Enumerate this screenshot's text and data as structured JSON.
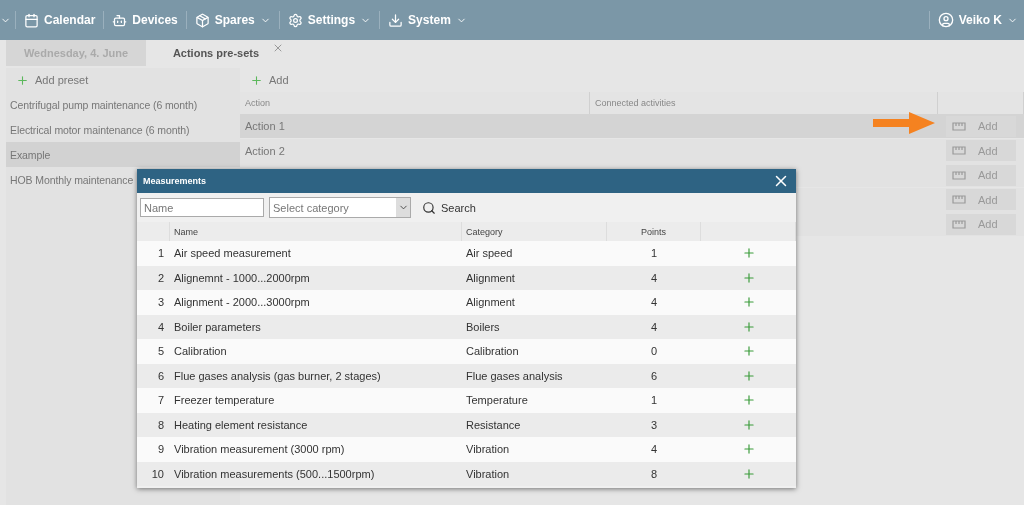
{
  "nav": {
    "items": [
      {
        "label": "Calendar",
        "has_menu": false
      },
      {
        "label": "Devices",
        "has_menu": false
      },
      {
        "label": "Spares",
        "has_menu": true
      },
      {
        "label": "Settings",
        "has_menu": true
      },
      {
        "label": "System",
        "has_menu": true
      }
    ],
    "user": {
      "name": "Veiko K",
      "has_menu": true
    }
  },
  "tabs": [
    {
      "label": "Wednesday, 4. June",
      "selected": false,
      "closable": false
    },
    {
      "label": "Actions pre-sets",
      "selected": true,
      "closable": true
    }
  ],
  "presets": {
    "add_label": "Add preset",
    "items": [
      {
        "label": "Centrifugal pump maintenance (6 month)",
        "selected": false
      },
      {
        "label": "Electrical motor maintenance (6 month)",
        "selected": false
      },
      {
        "label": "Example",
        "selected": true
      },
      {
        "label": "HOB Monthly maintenance",
        "selected": false
      }
    ]
  },
  "actions": {
    "add_label": "Add",
    "columns": [
      "Action",
      "Connected activities"
    ],
    "rows": [
      {
        "name": "Action 1",
        "selected": true,
        "button": "Add",
        "pointer": true
      },
      {
        "name": "Action 2",
        "selected": false,
        "button": "Add",
        "pointer": false
      },
      {
        "selected": false,
        "button": "Add",
        "pointer": false
      },
      {
        "selected": false,
        "button": "Add",
        "pointer": false
      },
      {
        "selected": false,
        "button": "Add",
        "pointer": false
      }
    ]
  },
  "dialog": {
    "title": "Measurements",
    "name_placeholder": "Name",
    "category_placeholder": "Select category",
    "search_label": "Search",
    "columns": [
      "Name",
      "Category",
      "Points"
    ],
    "rows": [
      {
        "index": "1",
        "name": "Air speed measurement",
        "category": "Air speed",
        "points": "1"
      },
      {
        "index": "2",
        "name": "Alignemnt - 1000...2000rpm",
        "category": "Alignment",
        "points": "4"
      },
      {
        "index": "3",
        "name": "Alignment - 2000...3000rpm",
        "category": "Alignment",
        "points": "4"
      },
      {
        "index": "4",
        "name": "Boiler parameters",
        "category": "Boilers",
        "points": "4"
      },
      {
        "index": "5",
        "name": "Calibration",
        "category": "Calibration",
        "points": "0"
      },
      {
        "index": "6",
        "name": "Flue gases analysis (gas burner, 2 stages)",
        "category": "Flue gases analysis",
        "points": "6"
      },
      {
        "index": "7",
        "name": "Freezer temperature",
        "category": "Temperature",
        "points": "1"
      },
      {
        "index": "8",
        "name": "Heating element resistance",
        "category": "Resistance",
        "points": "3"
      },
      {
        "index": "9",
        "name": "Vibration measurement (3000 rpm)",
        "category": "Vibration",
        "points": "4"
      },
      {
        "index": "10",
        "name": "Vibration measurements (500...1500rpm)",
        "category": "Vibration",
        "points": "8"
      }
    ]
  }
}
